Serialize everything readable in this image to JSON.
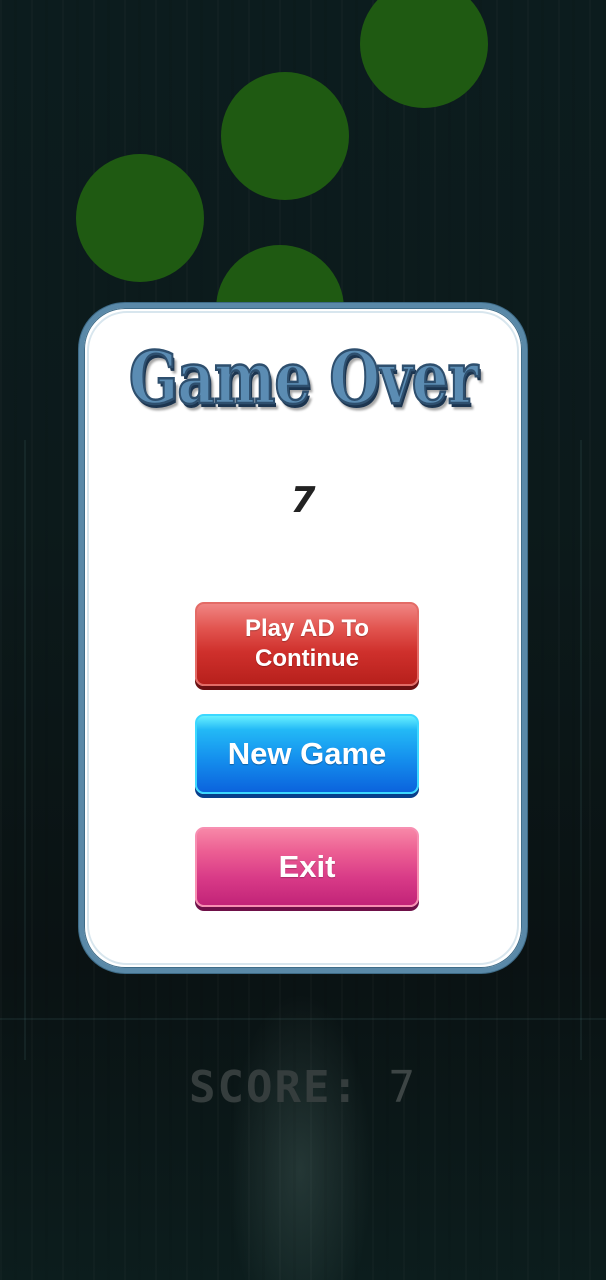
{
  "dialog": {
    "title": "Game Over",
    "score": "7",
    "buttons": {
      "play_ad": [
        "Play AD To",
        "Continue"
      ],
      "new_game": "New Game",
      "exit": "Exit"
    }
  },
  "hud": {
    "score_label": "SCORE:",
    "score_value": "7"
  },
  "colors": {
    "ball": "#1f5a12",
    "dialog_border": "#5a89a8",
    "title": "#5b8cb3",
    "play_ad_button": "#cf302c",
    "new_game_button": "#1591ee",
    "exit_button": "#d83a87"
  }
}
